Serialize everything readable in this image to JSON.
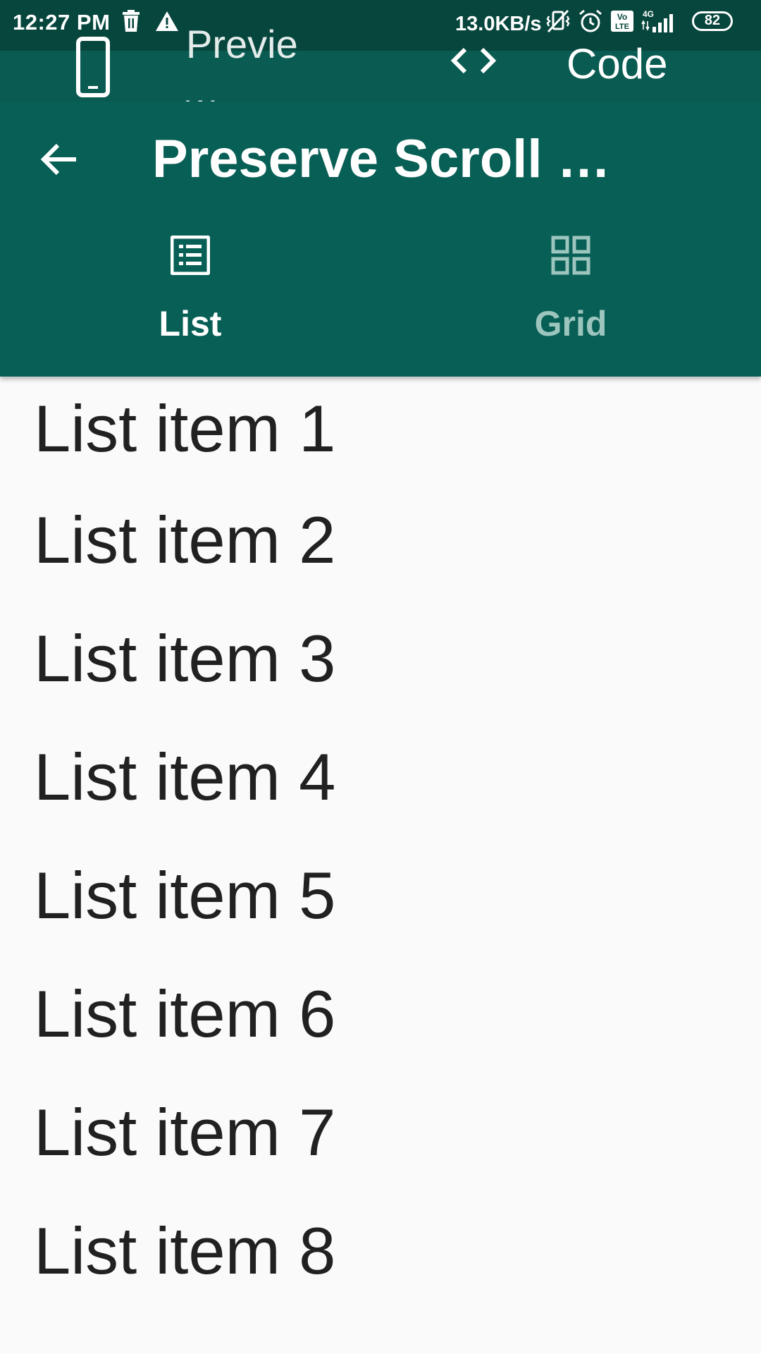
{
  "status_bar": {
    "time": "12:27 PM",
    "left_icons": [
      "trash-icon",
      "warning-icon"
    ],
    "network_speed": "13.0KB/s",
    "right_icons": [
      "vibrate-off-icon",
      "alarm-icon",
      "volte-icon",
      "4g-signal-icon"
    ],
    "battery": "82"
  },
  "preview_bar": {
    "preview_label": "Preview",
    "code_label": "Code"
  },
  "app_bar": {
    "title": "Preserve Scroll …",
    "tabs": [
      {
        "label": "List",
        "icon": "list-icon",
        "selected": true
      },
      {
        "label": "Grid",
        "icon": "grid-icon",
        "selected": false
      }
    ]
  },
  "list": {
    "items": [
      "List item 1",
      "List item 2",
      "List item 3",
      "List item 4",
      "List item 5",
      "List item 6",
      "List item 7",
      "List item 8"
    ]
  },
  "colors": {
    "status_bar": "#06463d",
    "preview_bar": "#0a5c52",
    "app_bar": "#085f55",
    "background": "#fafafa",
    "text": "#212121",
    "tab_inactive": "#9cc5be"
  }
}
